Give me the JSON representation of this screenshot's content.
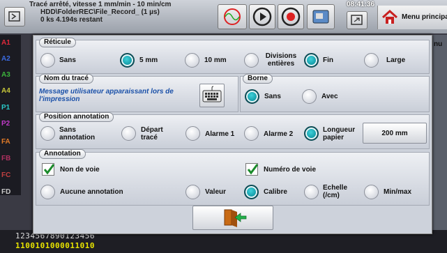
{
  "status": {
    "line1": "Tracé arrêté, vitesse 1 mm/min - 10 min/cm",
    "line2": "HDD\\FolderREC\\File_Record_ (1 µs)",
    "line3": "0 ks 4.194s restant"
  },
  "toolbar": {
    "time": "08:41:36",
    "menu_label": "Menu principal",
    "right_edge_text": "nu"
  },
  "channels": [
    {
      "label": "A1",
      "color": "#e0283a"
    },
    {
      "label": "A2",
      "color": "#3a6ae0"
    },
    {
      "label": "A3",
      "color": "#3cb43c"
    },
    {
      "label": "A4",
      "color": "#c8c83a"
    },
    {
      "label": "P1",
      "color": "#2ac8c8"
    },
    {
      "label": "P2",
      "color": "#c03ac8"
    },
    {
      "label": "FA",
      "color": "#e07a28"
    },
    {
      "label": "FB",
      "color": "#b03060"
    },
    {
      "label": "FC",
      "color": "#c04040"
    },
    {
      "label": "FD",
      "color": "#c8c8c8"
    }
  ],
  "bottom": {
    "digits_line1": "1234567890123456",
    "digits_line2": "1100101000011010"
  },
  "dialog": {
    "reticule": {
      "title": "Réticule",
      "options": [
        "Sans",
        "5 mm",
        "10 mm",
        "Divisions\nentières",
        "Fin",
        "Large"
      ],
      "selected_spacing": "5 mm",
      "selected_style": "Fin"
    },
    "nom_du_trace": {
      "title": "Nom du tracé",
      "message": "Message utilisateur apparaissant lors de l'impression"
    },
    "borne": {
      "title": "Borne",
      "options": [
        "Sans",
        "Avec"
      ],
      "selected": "Sans"
    },
    "position_annotation": {
      "title": "Position annotation",
      "options": [
        "Sans\nannotation",
        "Départ\ntracé",
        "Alarme 1",
        "Alarme 2",
        "Longueur\npapier"
      ],
      "selected": "Longueur papier",
      "length_value": "200 mm"
    },
    "annotation": {
      "title": "Annotation",
      "checkboxes": [
        {
          "label": "Non de voie",
          "checked": true
        },
        {
          "label": "Numéro de voie",
          "checked": true
        }
      ],
      "options": [
        "Aucune annotation",
        "Valeur",
        "Calibre",
        "Echelle\n(/cm)",
        "Min/max"
      ],
      "selected": "Calibre"
    },
    "exit_icon": "exit-door-icon"
  }
}
